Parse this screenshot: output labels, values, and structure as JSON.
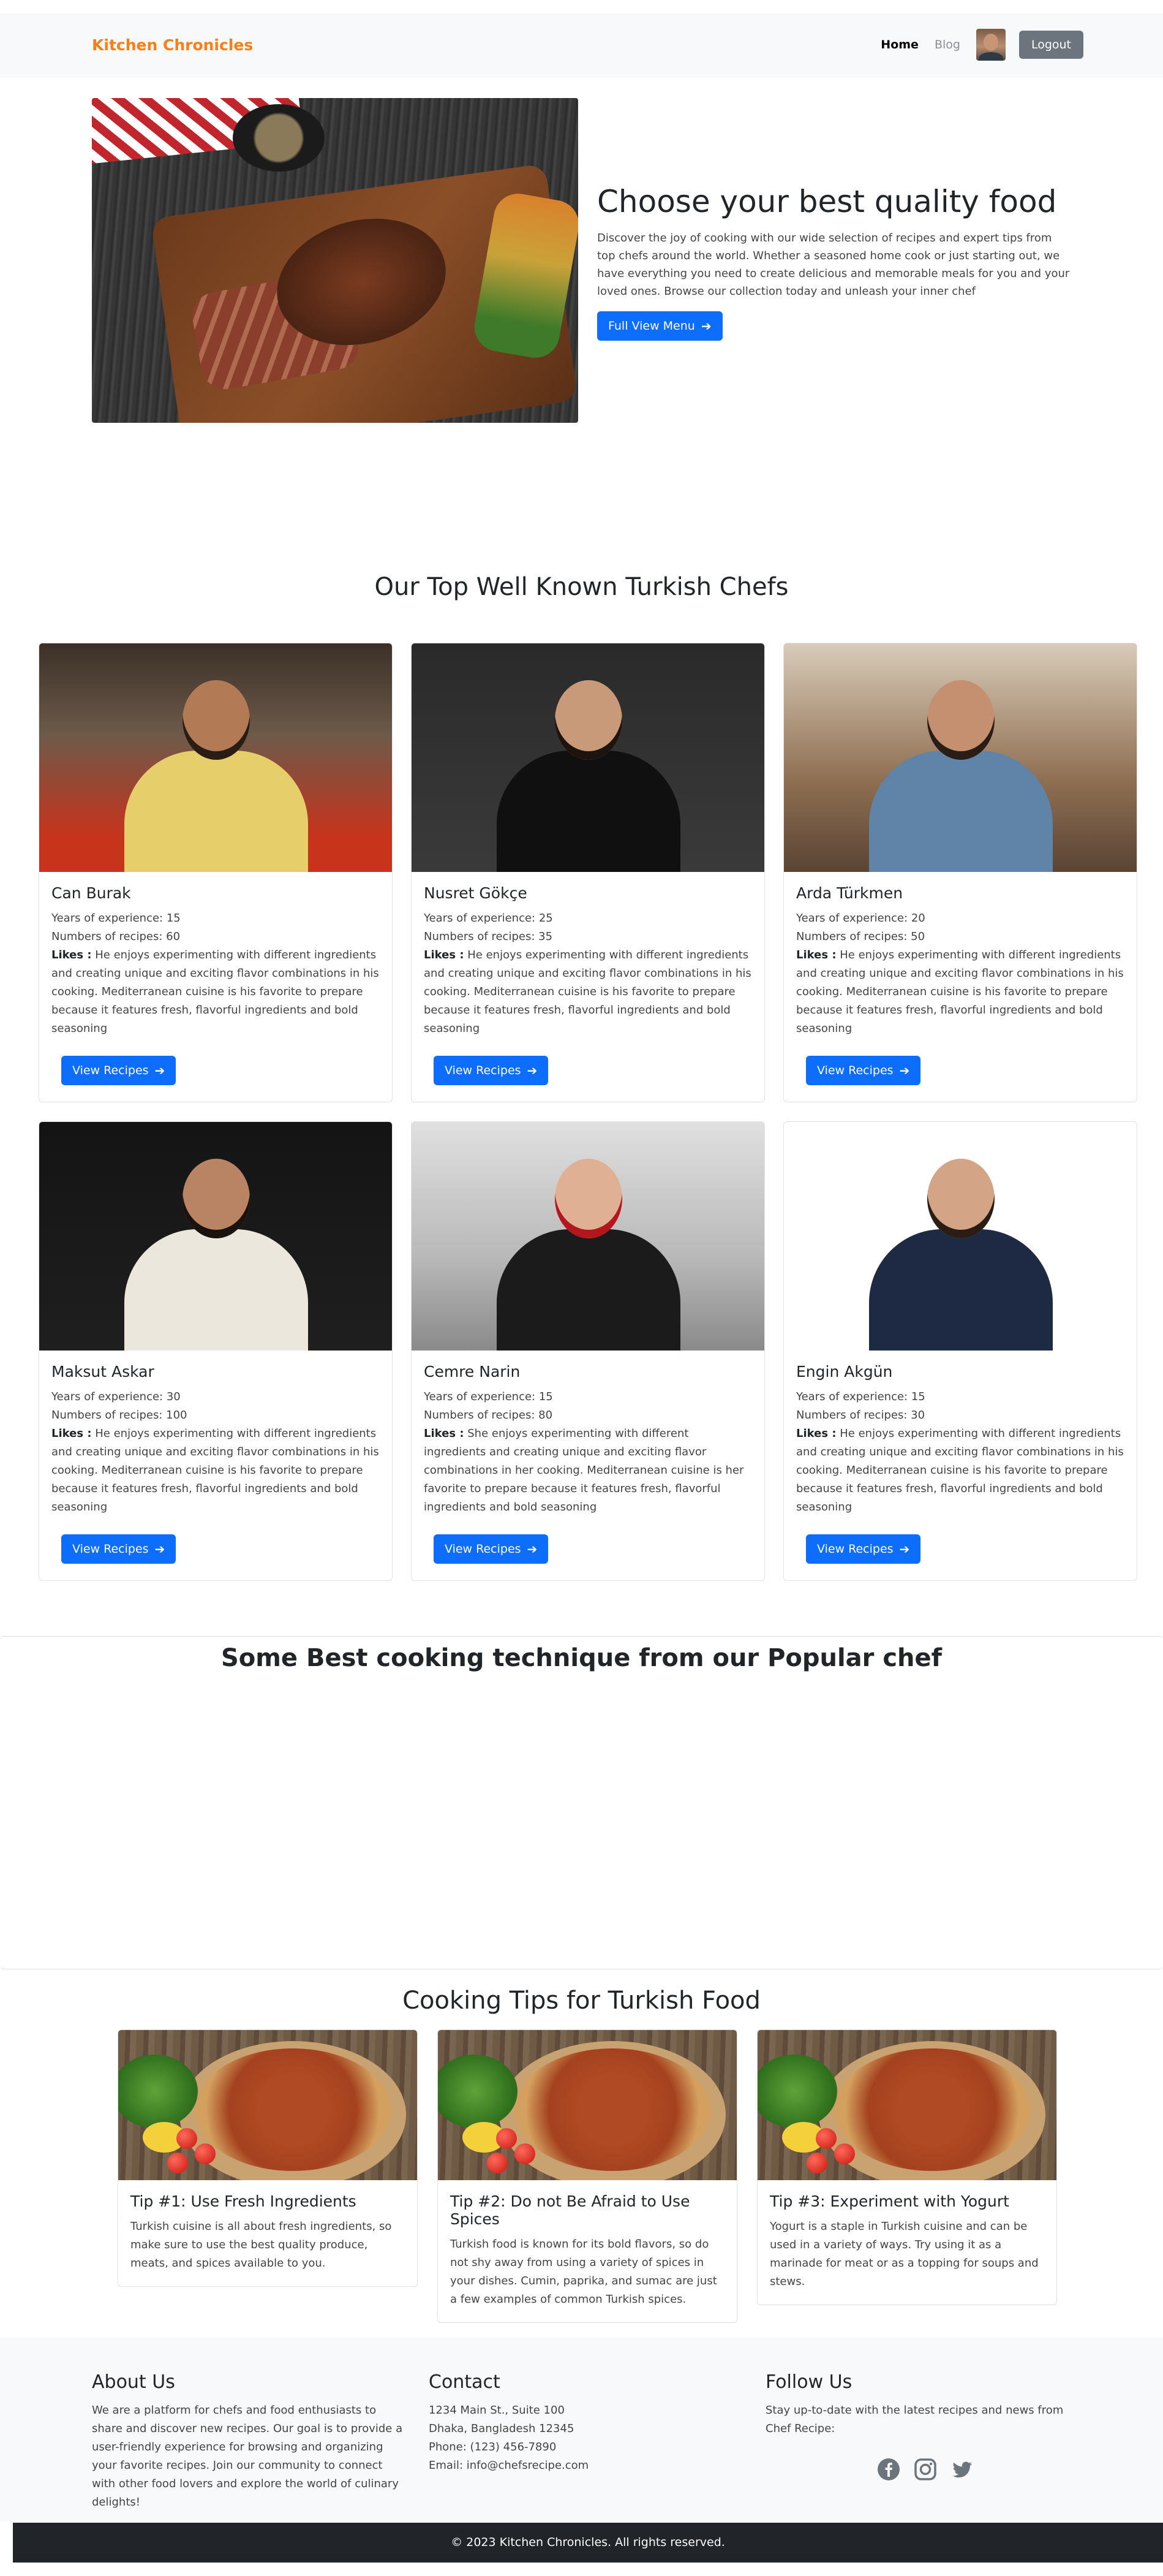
{
  "nav": {
    "brand": "Kitchen Chronicles",
    "links": [
      "Home",
      "Blog"
    ],
    "logout": "Logout"
  },
  "hero": {
    "title": "Choose your best quality food",
    "description": "Discover the joy of cooking with our wide selection of recipes and expert tips from top chefs around the world. Whether a seasoned home cook or just starting out, we have everything you need to create delicious and memorable meals for you and your loved ones. Browse our collection today and unleash your inner chef",
    "button": "Full View Menu"
  },
  "chefs_section": {
    "title": "Our Top Well Known Turkish Chefs",
    "button_label": "View Recipes",
    "likes_label": "Likes :",
    "chefs": [
      {
        "name": "Can Burak",
        "experience": "Years of experience: 15",
        "recipes": "Numbers of recipes: 60",
        "likes": "He enjoys experimenting with different ingredients and creating unique and exciting flavor combinations in his cooking. Mediterranean cuisine is his favorite to prepare because it features fresh, flavorful ingredients and bold seasoning"
      },
      {
        "name": "Nusret Gökçe",
        "experience": "Years of experience: 25",
        "recipes": "Numbers of recipes: 35",
        "likes": "He enjoys experimenting with different ingredients and creating unique and exciting flavor combinations in his cooking. Mediterranean cuisine is his favorite to prepare because it features fresh, flavorful ingredients and bold seasoning"
      },
      {
        "name": "Arda Türkmen",
        "experience": "Years of experience: 20",
        "recipes": "Numbers of recipes: 50",
        "likes": "He enjoys experimenting with different ingredients and creating unique and exciting flavor combinations in his cooking. Mediterranean cuisine is his favorite to prepare because it features fresh, flavorful ingredients and bold seasoning"
      },
      {
        "name": "Maksut Askar",
        "experience": "Years of experience: 30",
        "recipes": "Numbers of recipes: 100",
        "likes": "He enjoys experimenting with different ingredients and creating unique and exciting flavor combinations in his cooking. Mediterranean cuisine is his favorite to prepare because it features fresh, flavorful ingredients and bold seasoning"
      },
      {
        "name": "Cemre Narin",
        "experience": "Years of experience: 15",
        "recipes": "Numbers of recipes: 80",
        "likes": "She enjoys experimenting with different ingredients and creating unique and exciting flavor combinations in her cooking. Mediterranean cuisine is her favorite to prepare because it features fresh, flavorful ingredients and bold seasoning"
      },
      {
        "name": "Engin Akgün",
        "experience": "Years of experience: 15",
        "recipes": "Numbers of recipes: 30",
        "likes": "He enjoys experimenting with different ingredients and creating unique and exciting flavor combinations in his cooking. Mediterranean cuisine is his favorite to prepare because it features fresh, flavorful ingredients and bold seasoning"
      }
    ]
  },
  "technique": {
    "title": "Some Best cooking technique from our Popular chef"
  },
  "tips": {
    "title": "Cooking Tips for Turkish Food",
    "items": [
      {
        "title": "Tip #1: Use Fresh Ingredients",
        "text": "Turkish cuisine is all about fresh ingredients, so make sure to use the best quality produce, meats, and spices available to you."
      },
      {
        "title": "Tip #2: Do not Be Afraid to Use Spices",
        "text": "Turkish food is known for its bold flavors, so do not shy away from using a variety of spices in your dishes. Cumin, paprika, and sumac are just a few examples of common Turkish spices."
      },
      {
        "title": "Tip #3: Experiment with Yogurt",
        "text": "Yogurt is a staple in Turkish cuisine and can be used in a variety of ways. Try using it as a marinade for meat or as a topping for soups and stews."
      }
    ]
  },
  "footer": {
    "about_title": "About Us",
    "about_text": "We are a platform for chefs and food enthusiasts to share and discover new recipes. Our goal is to provide a user-friendly experience for browsing and organizing your favorite recipes. Join our community to connect with other food lovers and explore the world of culinary delights!",
    "contact_title": "Contact",
    "contact_lines": [
      "1234 Main St., Suite 100",
      "Dhaka, Bangladesh 12345",
      "Phone: (123) 456-7890",
      "Email: info@chefsrecipe.com"
    ],
    "follow_title": "Follow Us",
    "follow_text": "Stay up-to-date with the latest recipes and news from Chef Recipe:",
    "social_icons": [
      "facebook-icon",
      "instagram-icon",
      "twitter-icon"
    ],
    "copyright": "© 2023 Kitchen Chronicles. All rights reserved."
  },
  "colors": {
    "brand": "#fd7e14",
    "primary": "#0d6efd",
    "secondary": "#6c757d",
    "footer_dark": "#212529",
    "light_bg": "#f8f9fa"
  }
}
